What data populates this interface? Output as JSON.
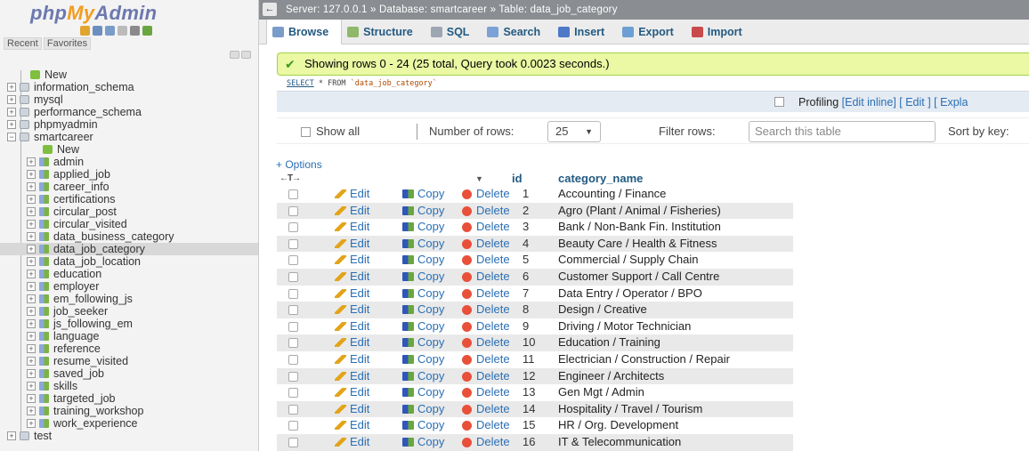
{
  "nav": {
    "logo_php": "php",
    "logo_my": "My",
    "logo_admin": "Admin",
    "recent": "Recent",
    "favorites": "Favorites",
    "tree": [
      {
        "label": "New",
        "type": "new",
        "level": 0
      },
      {
        "label": "information_schema",
        "type": "db",
        "level": 0
      },
      {
        "label": "mysql",
        "type": "db",
        "level": 0
      },
      {
        "label": "performance_schema",
        "type": "db",
        "level": 0
      },
      {
        "label": "phpmyadmin",
        "type": "db",
        "level": 0
      },
      {
        "label": "smartcareer",
        "type": "db",
        "level": 0,
        "expanded": true
      },
      {
        "label": "New",
        "type": "new",
        "level": 1
      },
      {
        "label": "admin",
        "type": "tbl",
        "level": 1
      },
      {
        "label": "applied_job",
        "type": "tbl",
        "level": 1
      },
      {
        "label": "career_info",
        "type": "tbl",
        "level": 1
      },
      {
        "label": "certifications",
        "type": "tbl",
        "level": 1
      },
      {
        "label": "circular_post",
        "type": "tbl",
        "level": 1
      },
      {
        "label": "circular_visited",
        "type": "tbl",
        "level": 1
      },
      {
        "label": "data_business_category",
        "type": "tbl",
        "level": 1
      },
      {
        "label": "data_job_category",
        "type": "tbl",
        "level": 1,
        "selected": true
      },
      {
        "label": "data_job_location",
        "type": "tbl",
        "level": 1
      },
      {
        "label": "education",
        "type": "tbl",
        "level": 1
      },
      {
        "label": "employer",
        "type": "tbl",
        "level": 1
      },
      {
        "label": "em_following_js",
        "type": "tbl",
        "level": 1
      },
      {
        "label": "job_seeker",
        "type": "tbl",
        "level": 1
      },
      {
        "label": "js_following_em",
        "type": "tbl",
        "level": 1
      },
      {
        "label": "language",
        "type": "tbl",
        "level": 1
      },
      {
        "label": "reference",
        "type": "tbl",
        "level": 1
      },
      {
        "label": "resume_visited",
        "type": "tbl",
        "level": 1
      },
      {
        "label": "saved_job",
        "type": "tbl",
        "level": 1
      },
      {
        "label": "skills",
        "type": "tbl",
        "level": 1
      },
      {
        "label": "targeted_job",
        "type": "tbl",
        "level": 1
      },
      {
        "label": "training_workshop",
        "type": "tbl",
        "level": 1
      },
      {
        "label": "work_experience",
        "type": "tbl",
        "level": 1
      },
      {
        "label": "test",
        "type": "db",
        "level": 0
      }
    ]
  },
  "breadcrumb": {
    "back": "←",
    "text": "Server: 127.0.0.1 » Database: smartcareer » Table: data_job_category"
  },
  "tabs": [
    {
      "label": "Browse",
      "active": true,
      "color": "#7a9cc9"
    },
    {
      "label": "Structure",
      "color": "#8fb86a"
    },
    {
      "label": "SQL",
      "color": "#9ea6b2"
    },
    {
      "label": "Search",
      "color": "#7aa2d6"
    },
    {
      "label": "Insert",
      "color": "#4d79c7"
    },
    {
      "label": "Export",
      "color": "#6d9fd4"
    },
    {
      "label": "Import",
      "color": "#c94a4a"
    }
  ],
  "notice": {
    "icon": "✔",
    "text": "Showing rows 0 - 24 (25 total, Query took 0.0023 seconds.)"
  },
  "sql": {
    "select": "SELECT",
    "rest": " * FROM ",
    "table": "`data_job_category`"
  },
  "profiling": {
    "label": "Profiling",
    "links": "[Edit inline] [ Edit ] [ Expla"
  },
  "filters": {
    "show_all": "Show all",
    "num_rows_label": "Number of rows:",
    "num_rows_value": "25",
    "filter_label": "Filter rows:",
    "search_placeholder": "Search this table",
    "sort_label": "Sort by key:"
  },
  "grid": {
    "options": "+ Options",
    "arrows": "←T→",
    "sort_icon": "▼",
    "col_id": "id",
    "col_name": "category_name",
    "action_edit": "Edit",
    "action_copy": "Copy",
    "action_delete": "Delete",
    "rows": [
      {
        "id": "1",
        "name": "Accounting / Finance"
      },
      {
        "id": "2",
        "name": "Agro (Plant / Animal / Fisheries)"
      },
      {
        "id": "3",
        "name": "Bank / Non-Bank Fin. Institution"
      },
      {
        "id": "4",
        "name": "Beauty Care / Health & Fitness"
      },
      {
        "id": "5",
        "name": "Commercial / Supply Chain"
      },
      {
        "id": "6",
        "name": "Customer Support / Call Centre"
      },
      {
        "id": "7",
        "name": "Data Entry / Operator / BPO"
      },
      {
        "id": "8",
        "name": "Design / Creative"
      },
      {
        "id": "9",
        "name": "Driving / Motor Technician"
      },
      {
        "id": "10",
        "name": "Education / Training"
      },
      {
        "id": "11",
        "name": "Electrician / Construction / Repair"
      },
      {
        "id": "12",
        "name": "Engineer / Architects"
      },
      {
        "id": "13",
        "name": "Gen Mgt / Admin"
      },
      {
        "id": "14",
        "name": "Hospitality / Travel / Tourism"
      },
      {
        "id": "15",
        "name": "HR / Org. Development"
      },
      {
        "id": "16",
        "name": "IT & Telecommunication"
      }
    ]
  }
}
